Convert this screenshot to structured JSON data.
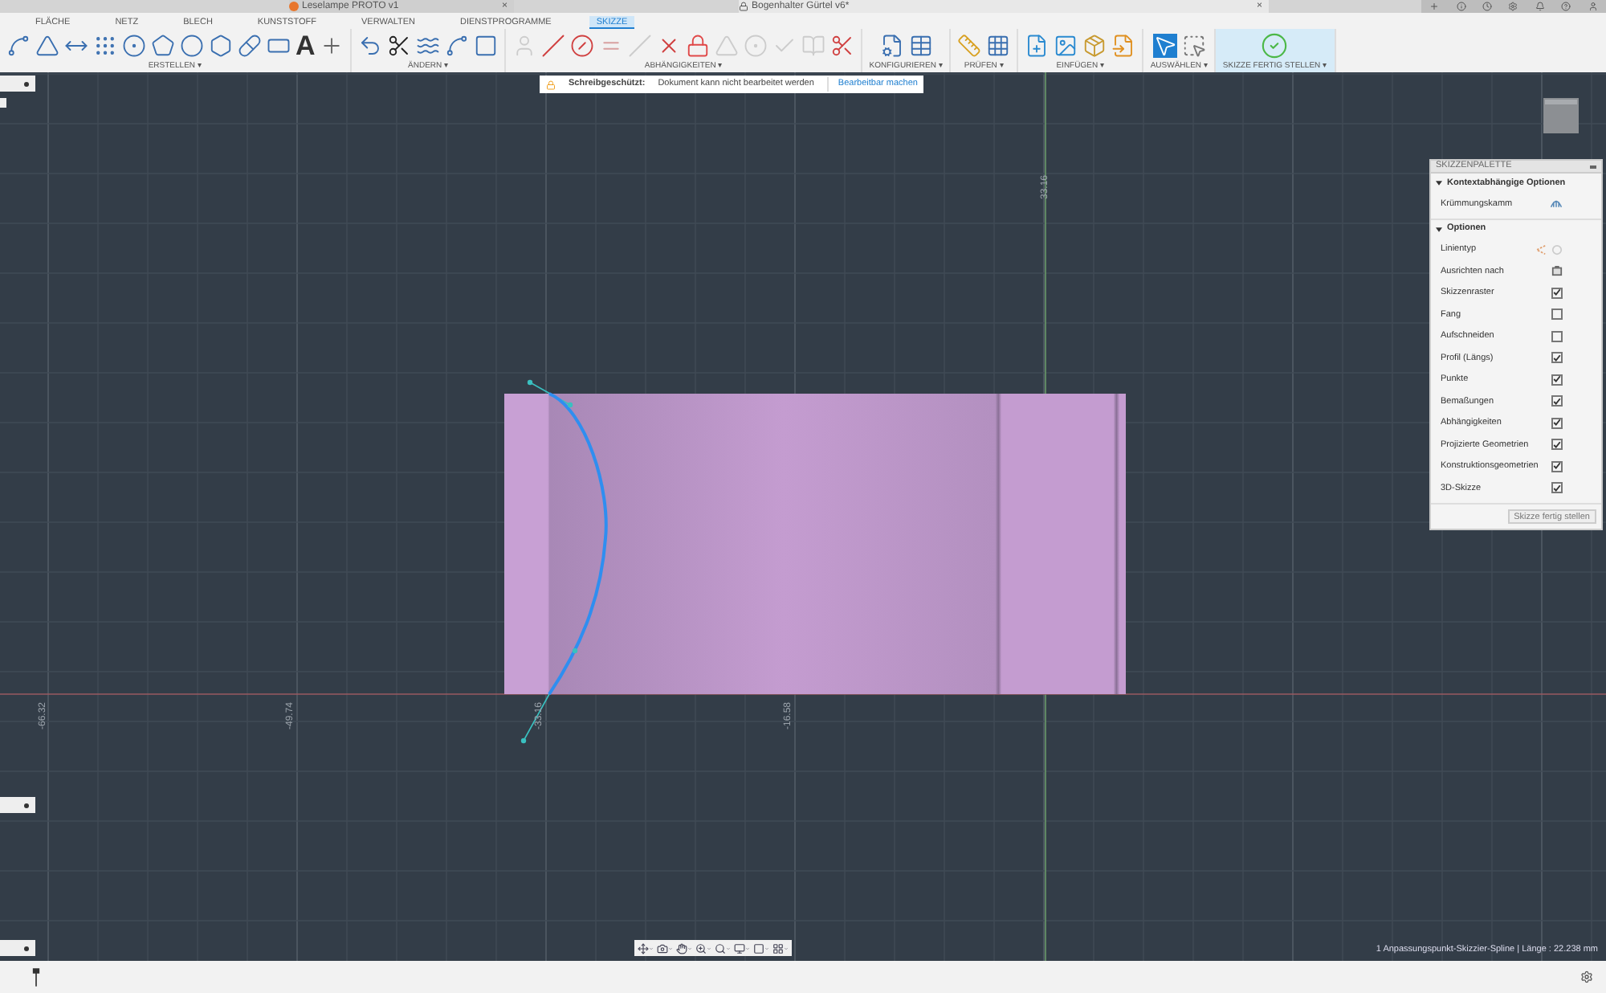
{
  "document_tabs": [
    {
      "title": "Leselampe PROTO v1",
      "close": "×",
      "selected": false
    },
    {
      "title": "Bogenhalter Gürtel v6*",
      "close": "×",
      "selected": true
    }
  ],
  "ribbon_tabs": [
    {
      "label": "FLÄCHE",
      "selected": false
    },
    {
      "label": "NETZ",
      "selected": false
    },
    {
      "label": "BLECH",
      "selected": false
    },
    {
      "label": "KUNSTSTOFF",
      "selected": false
    },
    {
      "label": "VERWALTEN",
      "selected": false
    },
    {
      "label": "DIENSTPROGRAMME",
      "selected": false
    },
    {
      "label": "SKIZZE",
      "selected": true
    }
  ],
  "tool_groups": [
    {
      "label": "ERSTELLEN ▾",
      "glyph": "A"
    },
    {
      "label": "ÄNDERN ▾"
    },
    {
      "label": "ABHÄNGIGKEITEN ▾"
    },
    {
      "label": "KONFIGURIEREN ▾"
    },
    {
      "label": "PRÜFEN ▾"
    },
    {
      "label": "EINFÜGEN ▾"
    },
    {
      "label": "AUSWÄHLEN ▾"
    },
    {
      "label": "SKIZZE FERTIG STELLEN ▾"
    }
  ],
  "banner": {
    "label": "Schreibgeschützt:",
    "message": "Dokument kann nicht bearbeitet werden",
    "action": "Bearbeitbar machen"
  },
  "axis_labels": [
    "-66.32",
    "-49.74",
    "-33.16",
    "-16.58",
    "33.16"
  ],
  "palette": {
    "title": "SKIZZENPALETTE",
    "sections": [
      {
        "title": "Kontextabhängige Optionen",
        "expanded": true,
        "rows": [
          {
            "label": "Krümmungskamm",
            "kind": "comb"
          }
        ]
      },
      {
        "title": "Optionen",
        "expanded": true,
        "rows": [
          {
            "label": "Linientyp",
            "kind": "linetype"
          },
          {
            "label": "Ausrichten nach",
            "kind": "align"
          },
          {
            "label": "Skizzenraster",
            "kind": "checkbox",
            "checked": true
          },
          {
            "label": "Fang",
            "kind": "checkbox",
            "checked": false
          },
          {
            "label": "Aufschneiden",
            "kind": "checkbox",
            "checked": false
          },
          {
            "label": "Profil (Längs)",
            "kind": "checkbox",
            "checked": true
          },
          {
            "label": "Punkte",
            "kind": "checkbox",
            "checked": true
          },
          {
            "label": "Bemaßungen",
            "kind": "checkbox",
            "checked": true
          },
          {
            "label": "Abhängigkeiten",
            "kind": "checkbox",
            "checked": true
          },
          {
            "label": "Projizierte Geometrien",
            "kind": "checkbox",
            "checked": true
          },
          {
            "label": "Konstruktionsgeometrien",
            "kind": "checkbox",
            "checked": true
          },
          {
            "label": "3D-Skizze",
            "kind": "checkbox",
            "checked": true
          }
        ]
      }
    ],
    "button": "Skizze fertig stellen"
  },
  "status": "1 Anpassungspunkt-Skizzier-Spline | Länge : 22.238 mm"
}
